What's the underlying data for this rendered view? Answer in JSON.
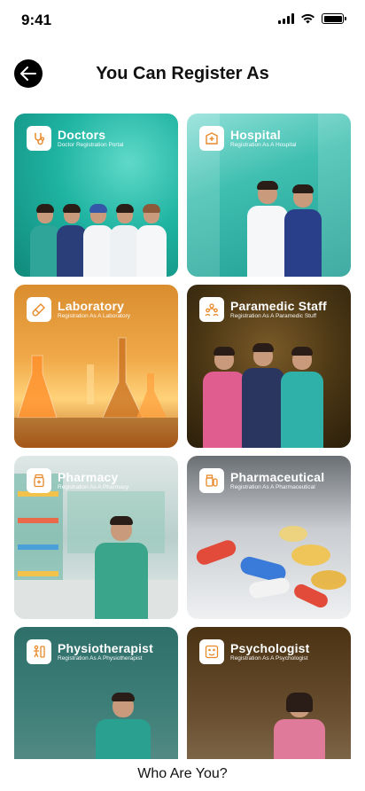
{
  "status_bar": {
    "time": "9:41"
  },
  "header": {
    "title": "You Can Register As"
  },
  "cards": [
    {
      "title": "Doctors",
      "subtitle": "Doctor Registration Portal"
    },
    {
      "title": "Hospital",
      "subtitle": "Registration As A Hospital"
    },
    {
      "title": "Laboratory",
      "subtitle": "Registration As A Laboratory"
    },
    {
      "title": "Paramedic Staff",
      "subtitle": "Registration As A Paramedic Stuff"
    },
    {
      "title": "Pharmacy",
      "subtitle": "Registration As A Pharmacy"
    },
    {
      "title": "Pharmaceutical",
      "subtitle": "Registration As A Pharmaceutical"
    },
    {
      "title": "Physiotherapist",
      "subtitle": "Registration As A Physiotherapist"
    },
    {
      "title": "Psychologist",
      "subtitle": "Registration As A Psychologist"
    }
  ],
  "footer": {
    "prompt": "Who Are You?"
  },
  "colors": {
    "teal": "#1fb3a1",
    "orange": "#e8892a",
    "navy": "#243a6b",
    "pink": "#e05d8f"
  }
}
